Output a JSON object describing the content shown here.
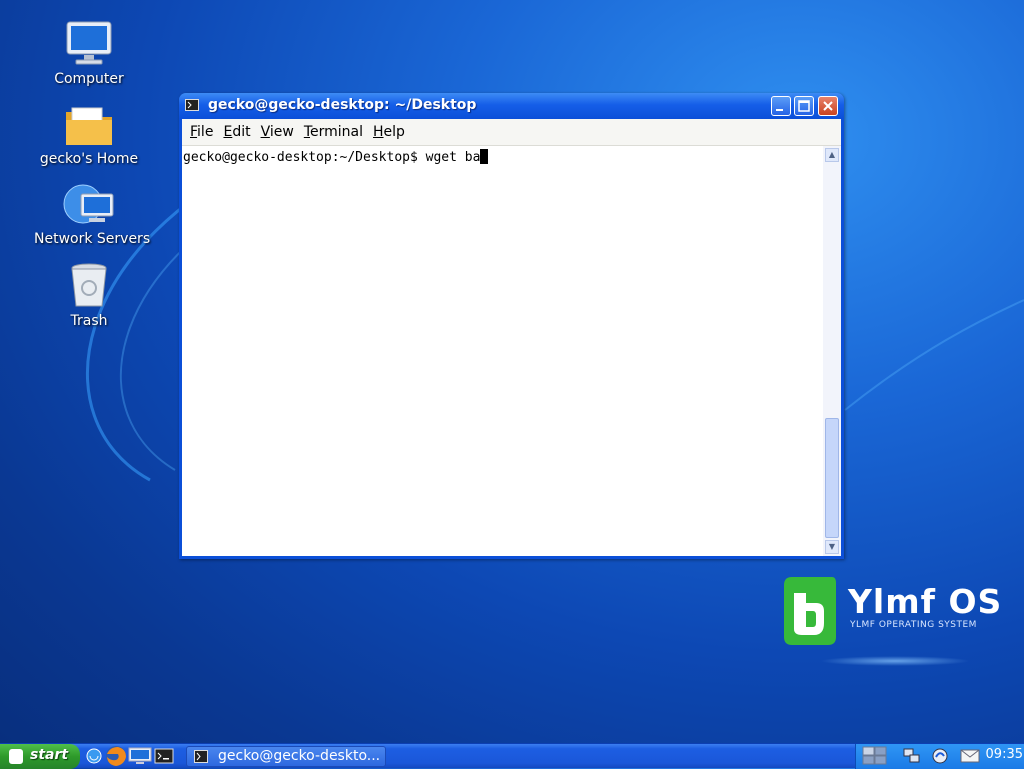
{
  "desktop": {
    "icons": [
      {
        "label": "Computer",
        "icon": "computer-icon"
      },
      {
        "label": "gecko's Home",
        "icon": "folder-icon"
      },
      {
        "label": "Network Servers",
        "icon": "network-icon"
      },
      {
        "label": "Trash",
        "icon": "trash-icon"
      }
    ]
  },
  "window": {
    "title": "gecko@gecko-desktop: ~/Desktop",
    "menu": [
      "File",
      "Edit",
      "View",
      "Terminal",
      "Help"
    ],
    "terminal": {
      "prompt": "gecko@gecko-desktop:~/Desktop$ ",
      "input": "wget ba"
    }
  },
  "logo": {
    "title": "Ylmf OS",
    "subtitle": "YLMF OPERATING SYSTEM"
  },
  "taskbar": {
    "start_label": "start",
    "task_label": "gecko@gecko-deskto...",
    "clock": "09:35"
  },
  "colors": {
    "titlebar": "#155ee8",
    "start_button": "#2e9a2a",
    "logo_green": "#36c23a"
  }
}
